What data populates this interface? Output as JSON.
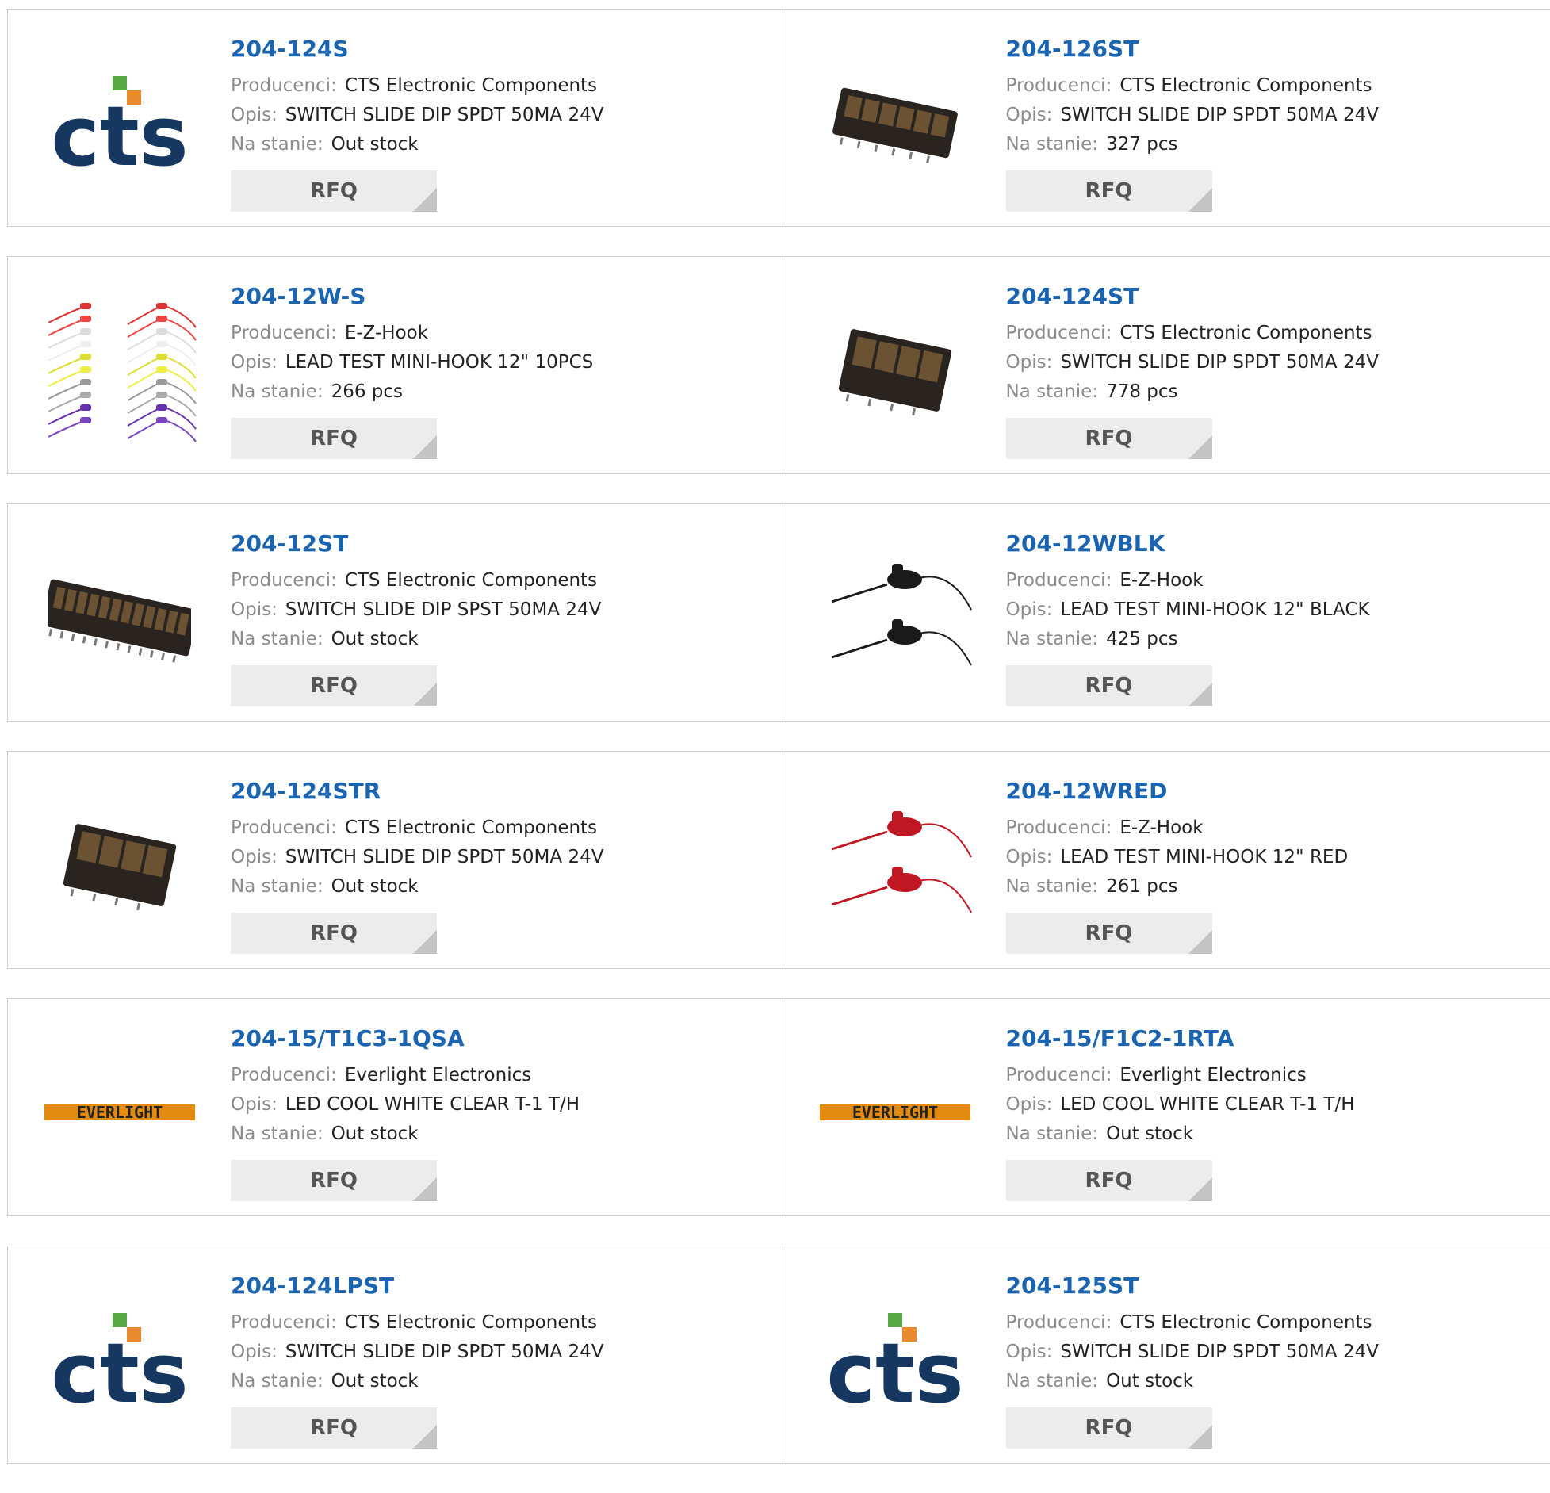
{
  "labels": {
    "manufacturer": "Producenci:",
    "description": "Opis:",
    "stock": "Na stanie:"
  },
  "rfq_label": "RFQ",
  "colors": {
    "part_link": "#1b64b0",
    "cts_blue": "#16375f",
    "cts_green": "#5aa844",
    "cts_orange": "#e98a2e",
    "everlight_orange": "#e38a10"
  },
  "products": [
    {
      "part": "204-124S",
      "manufacturer": "CTS Electronic Components",
      "description": "SWITCH SLIDE DIP SPDT 50MA 24V",
      "stock": "Out stock",
      "image": "cts-logo-icon"
    },
    {
      "part": "204-126ST",
      "manufacturer": "CTS Electronic Components",
      "description": "SWITCH SLIDE DIP SPDT 50MA 24V",
      "stock": "327 pcs",
      "image": "dip-switch-6-icon"
    },
    {
      "part": "204-12W-S",
      "manufacturer": "E-Z-Hook",
      "description": "LEAD TEST MINI-HOOK 12\" 10PCS",
      "stock": "266 pcs",
      "image": "test-leads-multicolor-icon"
    },
    {
      "part": "204-124ST",
      "manufacturer": "CTS Electronic Components",
      "description": "SWITCH SLIDE DIP SPDT 50MA 24V",
      "stock": "778 pcs",
      "image": "dip-switch-4-icon"
    },
    {
      "part": "204-12ST",
      "manufacturer": "CTS Electronic Components",
      "description": "SWITCH SLIDE DIP SPST 50MA 24V",
      "stock": "Out stock",
      "image": "dip-switch-12-icon"
    },
    {
      "part": "204-12WBLK",
      "manufacturer": "E-Z-Hook",
      "description": "LEAD TEST MINI-HOOK 12\" BLACK",
      "stock": "425 pcs",
      "image": "test-leads-black-icon"
    },
    {
      "part": "204-124STR",
      "manufacturer": "CTS Electronic Components",
      "description": "SWITCH SLIDE DIP SPDT 50MA 24V",
      "stock": "Out stock",
      "image": "dip-switch-4-icon"
    },
    {
      "part": "204-12WRED",
      "manufacturer": "E-Z-Hook",
      "description": "LEAD TEST MINI-HOOK 12\" RED",
      "stock": "261 pcs",
      "image": "test-leads-red-icon"
    },
    {
      "part": "204-15/T1C3-1QSA",
      "manufacturer": "Everlight Electronics",
      "description": "LED COOL WHITE CLEAR T-1 T/H",
      "stock": "Out stock",
      "image": "everlight-logo-icon",
      "logo_text": "EVERLIGHT"
    },
    {
      "part": "204-15/F1C2-1RTA",
      "manufacturer": "Everlight Electronics",
      "description": "LED COOL WHITE CLEAR T-1 T/H",
      "stock": "Out stock",
      "image": "everlight-logo-icon",
      "logo_text": "EVERLIGHT"
    },
    {
      "part": "204-124LPST",
      "manufacturer": "CTS Electronic Components",
      "description": "SWITCH SLIDE DIP SPDT 50MA 24V",
      "stock": "Out stock",
      "image": "cts-logo-icon"
    },
    {
      "part": "204-125ST",
      "manufacturer": "CTS Electronic Components",
      "description": "SWITCH SLIDE DIP SPDT 50MA 24V",
      "stock": "Out stock",
      "image": "cts-logo-icon"
    }
  ]
}
